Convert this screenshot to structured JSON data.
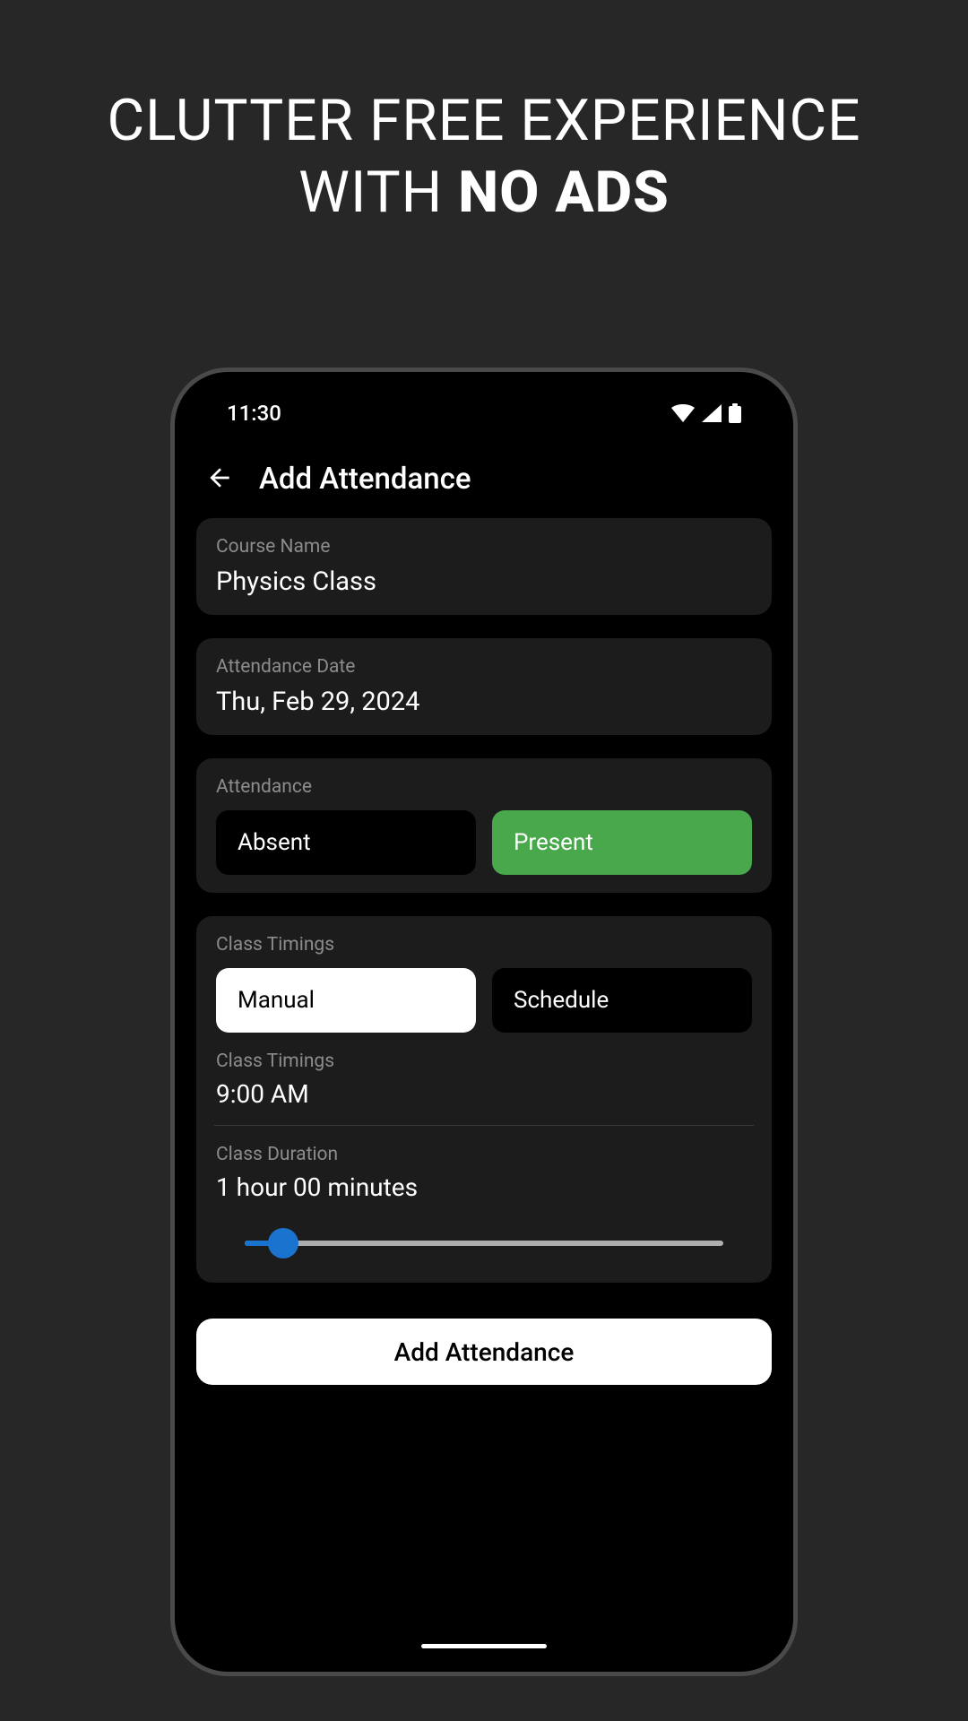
{
  "promo": {
    "line1": "CLUTTER FREE EXPERIENCE",
    "line2_prefix": "WITH ",
    "line2_bold": "NO ADS"
  },
  "status": {
    "time": "11:30"
  },
  "appbar": {
    "title": "Add Attendance"
  },
  "form": {
    "course": {
      "label": "Course Name",
      "value": "Physics Class"
    },
    "date": {
      "label": "Attendance Date",
      "value": "Thu, Feb 29, 2024"
    },
    "attendance": {
      "label": "Attendance",
      "absent": "Absent",
      "present": "Present"
    },
    "timings_mode": {
      "label": "Class Timings",
      "manual": "Manual",
      "schedule": "Schedule"
    },
    "timings": {
      "label": "Class Timings",
      "value": "9:00 AM"
    },
    "duration": {
      "label": "Class Duration",
      "value": "1 hour 00 minutes",
      "slider_percent": 8
    },
    "submit": "Add Attendance"
  }
}
